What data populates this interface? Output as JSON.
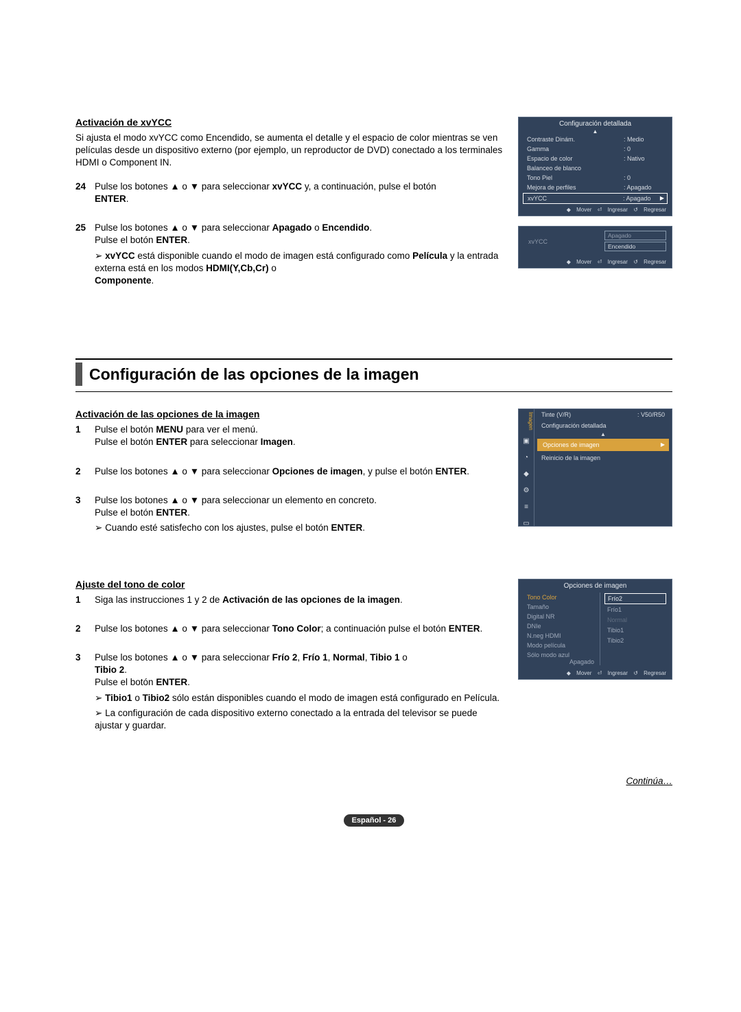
{
  "sec1": {
    "heading": "Activación de xvYCC",
    "intro": "Si ajusta el modo xvYCC como Encendido, se aumenta el detalle y el espacio de color mientras se ven películas desde un dispositivo externo (por ejemplo, un reproductor de DVD) conectado a los terminales HDMI o Component IN.",
    "step24_num": "24",
    "step24_a": "Pulse los botones ▲ o ▼ para seleccionar ",
    "step24_b": "xvYCC",
    "step24_c": " y, a continuación, pulse el botón ",
    "step24_d": "ENTER",
    "step24_e": ".",
    "step25_num": "25",
    "step25_a": "Pulse los botones ▲ o ▼ para seleccionar ",
    "step25_b": "Apagado",
    "step25_c": " o ",
    "step25_d": "Encendido",
    "step25_e": ".",
    "step25_f": "Pulse el botón ",
    "step25_g": "ENTER",
    "step25_h": ".",
    "note_a": "xvYCC",
    "note_b": " está disponible cuando el modo de imagen está configurado como ",
    "note_c": "Película",
    "note_d": " y la entrada externa está en los modos ",
    "note_e": "HDMI(Y,Cb,Cr)",
    "note_f": " o ",
    "note_g": "Componente",
    "note_h": "."
  },
  "osd1": {
    "title": "Configuración detallada",
    "rows": [
      {
        "k": "Contraste Dinám.",
        "v": ": Medio"
      },
      {
        "k": "Gamma",
        "v": ": 0"
      },
      {
        "k": "Espacio de color",
        "v": ": Nativo"
      },
      {
        "k": "Balanceo de blanco",
        "v": ""
      },
      {
        "k": "Tono Piel",
        "v": ": 0"
      },
      {
        "k": "Mejora de perfiles",
        "v": ": Apagado"
      }
    ],
    "sel": {
      "k": "xvYCC",
      "v": ": Apagado"
    },
    "foot_move": "Mover",
    "foot_enter": "Ingresar",
    "foot_back": "Regresar"
  },
  "osd2": {
    "label": "xvYCC",
    "opt_off": "Apagado",
    "opt_on": "Encendido",
    "foot_move": "Mover",
    "foot_enter": "Ingresar",
    "foot_back": "Regresar"
  },
  "sec2": {
    "title": "Configuración de las opciones de la imagen",
    "sub1_heading": "Activación de las opciones de la imagen",
    "s1_num": "1",
    "s1_a": "Pulse el botón ",
    "s1_b": "MENU",
    "s1_c": " para ver el menú.",
    "s1_d": "Pulse el botón ",
    "s1_e": "ENTER",
    "s1_f": " para seleccionar ",
    "s1_g": "Imagen",
    "s1_h": ".",
    "s2_num": "2",
    "s2_a": "Pulse los botones ▲ o ▼ para seleccionar ",
    "s2_b": "Opciones de imagen",
    "s2_c": ", y pulse el botón ",
    "s2_d": "ENTER",
    "s2_e": ".",
    "s3_num": "3",
    "s3_a": "Pulse los botones ▲ o ▼ para seleccionar un elemento en concreto.",
    "s3_b": "Pulse el botón ",
    "s3_c": "ENTER",
    "s3_d": ".",
    "s3_note": "Cuando esté satisfecho con los ajustes, pulse el botón ",
    "s3_note_b": "ENTER",
    "s3_note_c": "."
  },
  "osd3": {
    "side_label": "Imagen",
    "row_tint_k": "Tinte (V/R)",
    "row_tint_v": ": V50/R50",
    "row_conf": "Configuración detallada",
    "row_opc": "Opciones de imagen",
    "row_reset": "Reinicio de la imagen"
  },
  "sec3": {
    "heading": "Ajuste del tono de color",
    "s1_num": "1",
    "s1_a": "Siga las instrucciones 1 y 2 de ",
    "s1_b": "Activación de las opciones de la imagen",
    "s1_c": ".",
    "s2_num": "2",
    "s2_a": "Pulse los botones ▲ o ▼ para seleccionar ",
    "s2_b": "Tono Color",
    "s2_c": "; a continuación pulse el botón ",
    "s2_d": "ENTER",
    "s2_e": ".",
    "s3_num": "3",
    "s3_a": "Pulse los botones ▲ o ▼ para seleccionar ",
    "s3_b": "Frío 2",
    "s3_c": ", ",
    "s3_d": "Frío 1",
    "s3_e": ", ",
    "s3_f": "Normal",
    "s3_g": ", ",
    "s3_h": "Tibio 1",
    "s3_i": " o ",
    "s3_j": "Tibio 2",
    "s3_k": ".",
    "s3_l": "Pulse el botón ",
    "s3_m": "ENTER",
    "s3_n": ".",
    "note1_a": "Tibio1",
    "note1_b": " o ",
    "note1_c": "Tibio2",
    "note1_d": " sólo están disponibles cuando el modo de imagen está configurado en Película.",
    "note2": "La configuración de cada dispositivo externo conectado a la entrada del televisor se puede ajustar y guardar."
  },
  "osd4": {
    "title": "Opciones de imagen",
    "left": [
      {
        "t": "Tono Color",
        "on": true
      },
      {
        "t": "Tamaño"
      },
      {
        "t": "Digital NR"
      },
      {
        "t": "DNIe"
      },
      {
        "t": "N.neg HDMI"
      },
      {
        "t": "Modo película"
      },
      {
        "t": "Sólo modo azul"
      }
    ],
    "left_val_last": "Apagado",
    "right": [
      {
        "t": "Frío2",
        "sel": true
      },
      {
        "t": "Frío1"
      },
      {
        "t": "Normal",
        "dim": true
      },
      {
        "t": "Tibio1"
      },
      {
        "t": "Tibio2"
      }
    ],
    "foot_move": "Mover",
    "foot_enter": "Ingresar",
    "foot_back": "Regresar"
  },
  "continua": "Continúa…",
  "footer": "Español - 26"
}
